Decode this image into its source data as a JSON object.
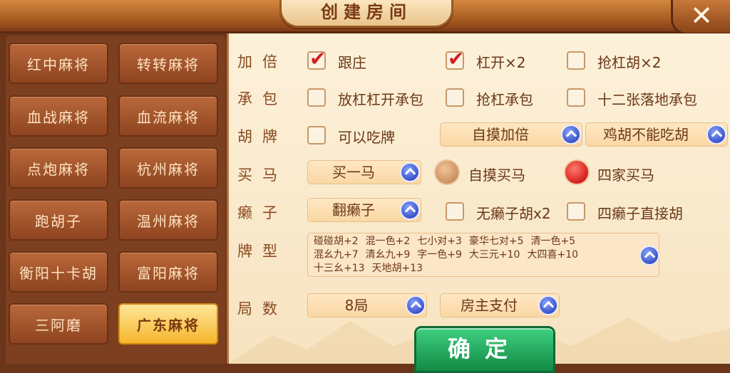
{
  "header": {
    "title": "创建房间",
    "close_label": "✕"
  },
  "sidebar": {
    "items": [
      {
        "label": "红中麻将",
        "active": false
      },
      {
        "label": "转转麻将",
        "active": false
      },
      {
        "label": "血战麻将",
        "active": false
      },
      {
        "label": "血流麻将",
        "active": false
      },
      {
        "label": "点炮麻将",
        "active": false
      },
      {
        "label": "杭州麻将",
        "active": false
      },
      {
        "label": "跑胡子",
        "active": false
      },
      {
        "label": "温州麻将",
        "active": false
      },
      {
        "label": "衡阳十卡胡",
        "active": false
      },
      {
        "label": "富阳麻将",
        "active": false
      },
      {
        "label": "三阿磨",
        "active": false
      },
      {
        "label": "广东麻将",
        "active": true
      }
    ]
  },
  "rows": {
    "jiabei": {
      "label": "加倍",
      "options": [
        {
          "label": "跟庄",
          "checked": true
        },
        {
          "label": "杠开×2",
          "checked": true
        },
        {
          "label": "抢杠胡×2",
          "checked": false
        }
      ]
    },
    "chengbao": {
      "label": "承包",
      "options": [
        {
          "label": "放杠杠开承包",
          "checked": false
        },
        {
          "label": "抢杠承包",
          "checked": false
        },
        {
          "label": "十二张落地承包",
          "checked": false
        }
      ]
    },
    "hupai": {
      "label": "胡牌",
      "option": {
        "label": "可以吃牌",
        "checked": false
      },
      "dropdowns": [
        "自摸加倍",
        "鸡胡不能吃胡"
      ]
    },
    "maima": {
      "label": "买马",
      "dropdown": "买一马",
      "radios": [
        {
          "label": "自摸买马",
          "selected": false
        },
        {
          "label": "四家买马",
          "selected": true
        }
      ]
    },
    "laizi": {
      "label": "癞子",
      "dropdown": "翻癞子",
      "options": [
        {
          "label": "无癞子胡x2",
          "checked": false
        },
        {
          "label": "四癞子直接胡",
          "checked": false
        }
      ]
    },
    "paixing": {
      "label": "牌型",
      "types": [
        "碰碰胡+2",
        "混一色+2",
        "七小对+3",
        "豪华七对+5",
        "清一色+5",
        "混幺九+7",
        "清幺九+9",
        "字一色+9",
        "大三元+10",
        "大四喜+10",
        "十三幺+13",
        "天地胡+13"
      ]
    },
    "jushu": {
      "label": "局数",
      "dropdowns": [
        "8局",
        "房主支付"
      ]
    }
  },
  "confirm_label": "确定",
  "colors": {
    "check": "#d41e1e",
    "confirm": "#1fa356",
    "arrow": "#3a52c8",
    "active_tab": "#f5b62d"
  }
}
